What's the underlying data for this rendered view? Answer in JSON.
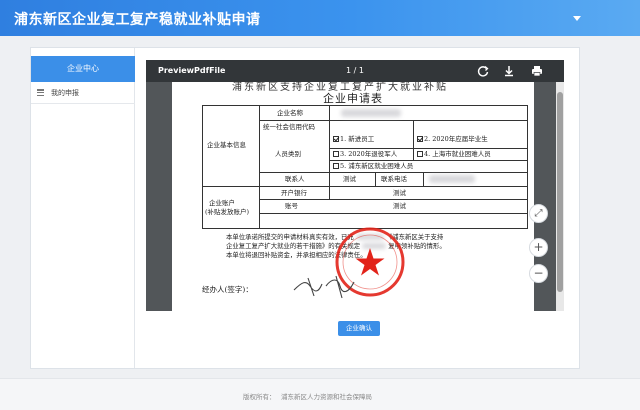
{
  "app": {
    "title": "浦东新区企业复工复产稳就业补贴申请"
  },
  "sidebar": {
    "active_label": "企业中心",
    "items": [
      {
        "label": "我的申报",
        "icon": "list-icon"
      }
    ]
  },
  "viewer": {
    "file_name": "PreviewPdfFile",
    "page_indicator": "1 / 1",
    "icons": [
      "refresh-icon",
      "download-icon",
      "print-icon"
    ]
  },
  "document": {
    "header_partial": "浦东新区支持企业复工复产扩大就业补贴",
    "title": "企业申请表",
    "section_basic": "企业基本信息",
    "company_name_label": "企业名称",
    "credit_code_label": "统一社会信用代码",
    "staff_type_label": "人员类别",
    "staff_options": [
      {
        "label": "1. 新进员工",
        "checked": true
      },
      {
        "label": "2. 2020年应届毕业生",
        "checked": true
      },
      {
        "label": "3. 2020年退役军人",
        "checked": false
      },
      {
        "label": "4. 上海市就业困难人员",
        "checked": false
      },
      {
        "label": "5. 浦东新区就业困难人员",
        "checked": false
      }
    ],
    "contact_label": "联系人",
    "contact_value": "测试",
    "phone_label": "联系电话",
    "section_account": "企业账户",
    "section_account_sub": "(补贴发放账户)",
    "bank_label": "开户银行",
    "bank_value": "测试",
    "account_label": "账号",
    "account_value": "测试",
    "statement_line1": "本单位承诺所提交的申请材料真实有效，已充",
    "statement_line1_end": "《浦东新区关于支持",
    "statement_line2": "企业复工复产扩大就业的若干措施》的有关规定",
    "statement_line2_end": "复申领补贴的情形。",
    "statement_line3": "本单位将退回补贴资金，并承担相应的法律责任。",
    "signature_label": "经办人(签字)："
  },
  "actions": {
    "confirm_label": "企业确认"
  },
  "zoom": {
    "fit": "⤢",
    "in": "+",
    "out": "−"
  },
  "footer": {
    "copyright_label": "版权所有：",
    "owner": "浦东新区人力资源和社会保障局"
  },
  "colors": {
    "accent": "#3b8fe8",
    "header_start": "#2f7fe0",
    "seal_red": "#e2231a"
  }
}
